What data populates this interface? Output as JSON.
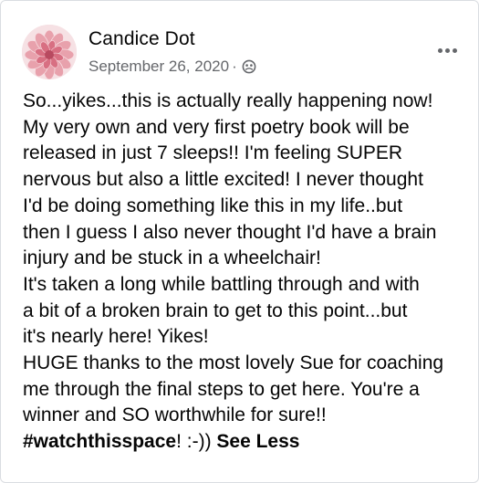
{
  "post": {
    "author": "Candice Dot",
    "date": "September 26, 2020",
    "separator": "·",
    "audience_icon": "group-audience-icon",
    "more_icon": "more-options-icon",
    "lines": [
      "So...yikes...this is actually really happening now!",
      "My very own and very first poetry book will be",
      "released in just 7 sleeps!! I'm feeling SUPER",
      "nervous but also a little excited! I never thought",
      "I'd be doing something like this in my life..but",
      "then I guess I also never thought I'd have a brain",
      "injury and be stuck in a wheelchair!",
      "It's taken a long while battling through and with",
      "a bit of a broken brain to get to this point...but",
      "it's nearly here! Yikes!",
      "HUGE thanks to the most lovely Sue for coaching",
      "me through the final steps to get here. You're a",
      "winner and SO worthwhile for sure!!"
    ],
    "hashtag": "#watchthisspace",
    "hashtag_suffix": "! :-))",
    "see_less": "See Less"
  },
  "colors": {
    "text": "#050505",
    "secondary": "#65676b",
    "border": "#dadde1"
  }
}
